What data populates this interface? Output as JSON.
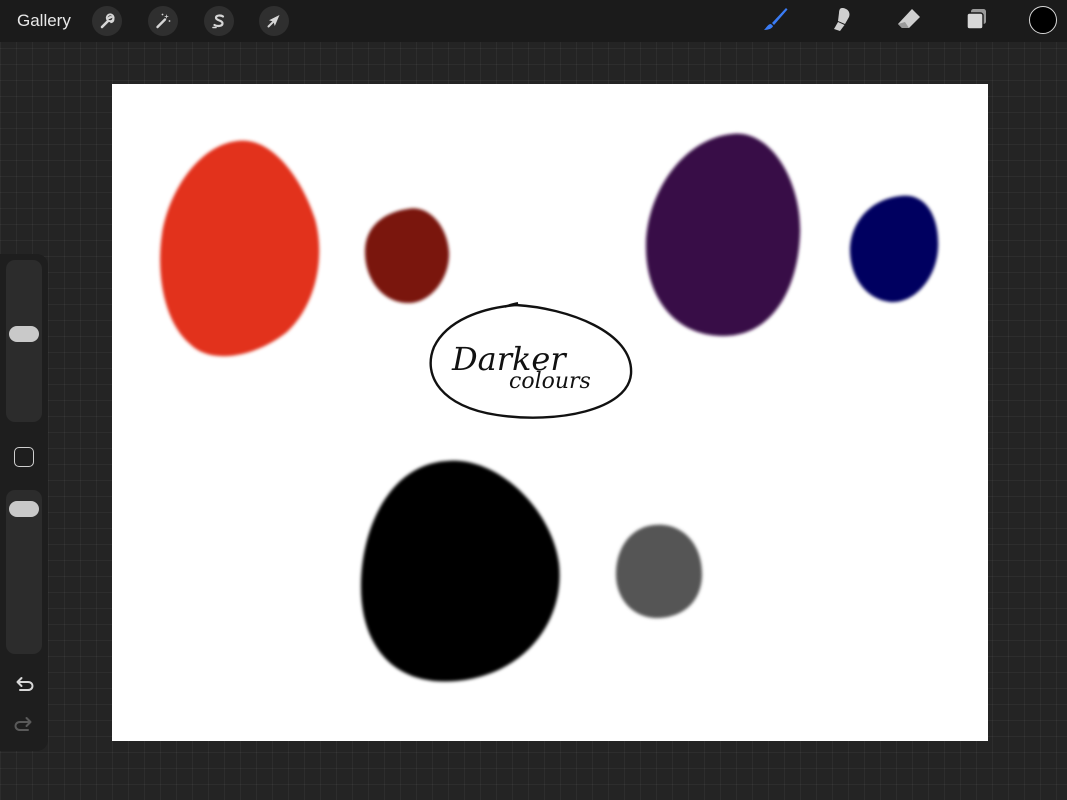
{
  "topbar": {
    "gallery_label": "Gallery",
    "actions_icon": "wrench-icon",
    "adjustments_icon": "magic-wand-icon",
    "selection_icon": "selection-s-icon",
    "transform_icon": "arrow-cursor-icon",
    "brush_icon": "brush-icon",
    "smudge_icon": "smudge-icon",
    "eraser_icon": "eraser-icon",
    "layers_icon": "layers-icon",
    "active_tool_color": "#3a7cf5",
    "current_color": "#000000"
  },
  "sidebar": {
    "brush_size_level": 0.55,
    "opacity_level": 0.05,
    "modify_icon": "square-modify-icon",
    "undo_icon": "undo-arrow-icon",
    "redo_icon": "redo-arrow-icon"
  },
  "canvas": {
    "background": "#ffffff",
    "blobs": [
      {
        "name": "red-blob",
        "color": "#e2321f"
      },
      {
        "name": "dark-red-blob",
        "color": "#7a130e"
      },
      {
        "name": "purple-blob",
        "color": "#380847"
      },
      {
        "name": "navy-blob",
        "color": "#050561"
      },
      {
        "name": "black-blob",
        "color": "#000000"
      },
      {
        "name": "gray-blob",
        "color": "#545454"
      }
    ],
    "annotation": {
      "line1": "Darker",
      "line2": "colours"
    }
  }
}
